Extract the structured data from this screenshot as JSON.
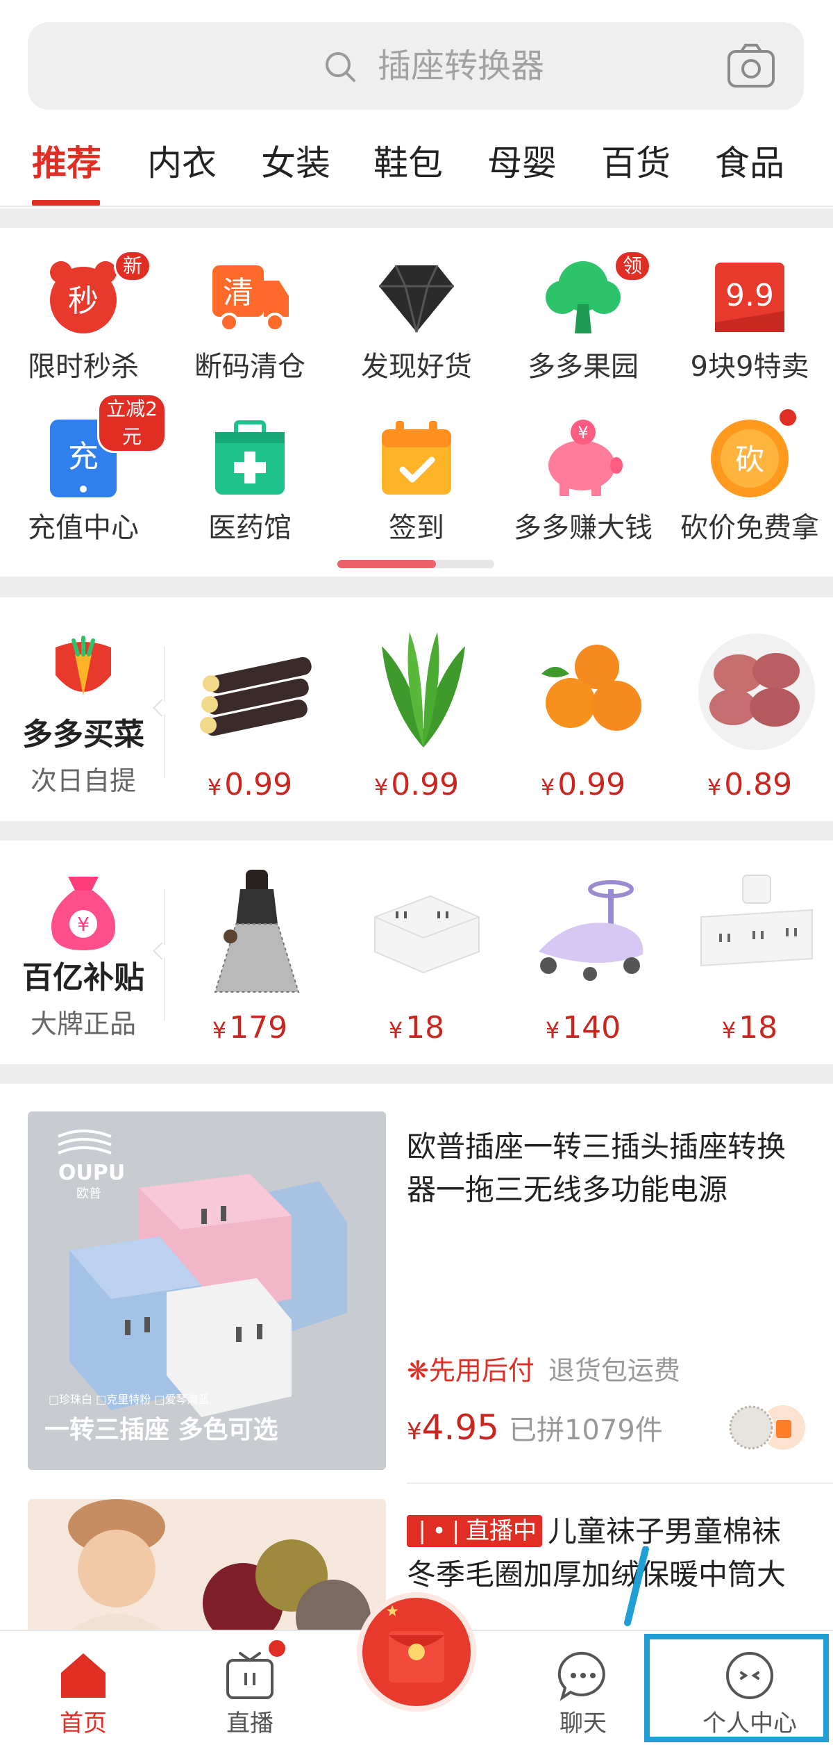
{
  "search": {
    "placeholder": "插座转换器",
    "icon": "search-icon",
    "camera_icon": "camera-icon"
  },
  "tabs": [
    {
      "label": "推荐",
      "active": true
    },
    {
      "label": "内衣"
    },
    {
      "label": "女装"
    },
    {
      "label": "鞋包"
    },
    {
      "label": "母婴"
    },
    {
      "label": "百货"
    },
    {
      "label": "食品"
    }
  ],
  "grid": [
    {
      "label": "限时秒杀",
      "icon": "flash-sale-clock-icon",
      "icon_text": "秒",
      "badge": "新",
      "color": "#e8392d"
    },
    {
      "label": "断码清仓",
      "icon": "clearance-truck-icon",
      "icon_text": "清",
      "color": "#ff6a2b"
    },
    {
      "label": "发现好货",
      "icon": "diamond-icon",
      "color": "#333333"
    },
    {
      "label": "多多果园",
      "icon": "tree-icon",
      "badge": "领",
      "color": "#2cc36b"
    },
    {
      "label": "9块9特卖",
      "icon": "sale-tag-icon",
      "icon_text": "9.9",
      "color": "#e8392d"
    },
    {
      "label": "充值中心",
      "icon": "phone-recharge-icon",
      "icon_text": "充",
      "badge": "立减2元",
      "color": "#2f80ed"
    },
    {
      "label": "医药馆",
      "icon": "medical-kit-icon",
      "color": "#1fc28a"
    },
    {
      "label": "签到",
      "icon": "calendar-check-icon",
      "color": "#ffb428"
    },
    {
      "label": "多多赚大钱",
      "icon": "piggy-bank-icon",
      "icon_text": "¥",
      "color": "#ff7d9a"
    },
    {
      "label": "砍价免费拿",
      "icon": "bargain-coin-icon",
      "icon_text": "砍",
      "reddot": true,
      "color": "#ff9a1f"
    }
  ],
  "grocery": {
    "title": "多多买菜",
    "subtitle": "次日自提",
    "items": [
      {
        "price": "0.99",
        "icon": "sugarcane-image"
      },
      {
        "price": "0.99",
        "icon": "lettuce-image"
      },
      {
        "price": "0.99",
        "icon": "oranges-image"
      },
      {
        "price": "0.89",
        "icon": "potatoes-image"
      }
    ]
  },
  "subsidy": {
    "title": "百亿补贴",
    "subtitle": "大牌正品",
    "items": [
      {
        "price": "179",
        "icon": "dress-image"
      },
      {
        "price": "18",
        "icon": "power-socket-image"
      },
      {
        "price": "140",
        "icon": "kids-scooter-image"
      },
      {
        "price": "18",
        "icon": "wall-socket-image"
      }
    ]
  },
  "products": [
    {
      "title": "欧普插座一转三插头插座转换器一拖三无线多功能电源",
      "image_brand": "OUPU",
      "image_brand_sub": "欧普",
      "image_caption": "一转三插座 多色可选",
      "image_colors": "□珍珠白 □克里特粉 □爱琴海蓝",
      "pay_tag": "先用后付",
      "return_tag": "退货包运费",
      "currency": "¥",
      "price": "4.95",
      "sold": "已拼1079件"
    },
    {
      "live_tag": "直播中",
      "title": "儿童袜子男童棉袜冬季毛圈加厚加绒保暖中筒大",
      "currency": "¥"
    }
  ],
  "price_currency": "¥",
  "nav": [
    {
      "label": "首页",
      "icon": "home-icon",
      "active": true
    },
    {
      "label": "直播",
      "icon": "live-tv-icon",
      "reddot": true
    },
    {
      "label": "",
      "icon": "red-envelope-icon"
    },
    {
      "label": "聊天",
      "icon": "chat-icon"
    },
    {
      "label": "个人中心",
      "icon": "profile-icon",
      "highlighted": true
    }
  ],
  "colors": {
    "brand_red": "#e02e24",
    "price_red": "#c8261e",
    "highlight_blue": "#1f9fd6"
  }
}
